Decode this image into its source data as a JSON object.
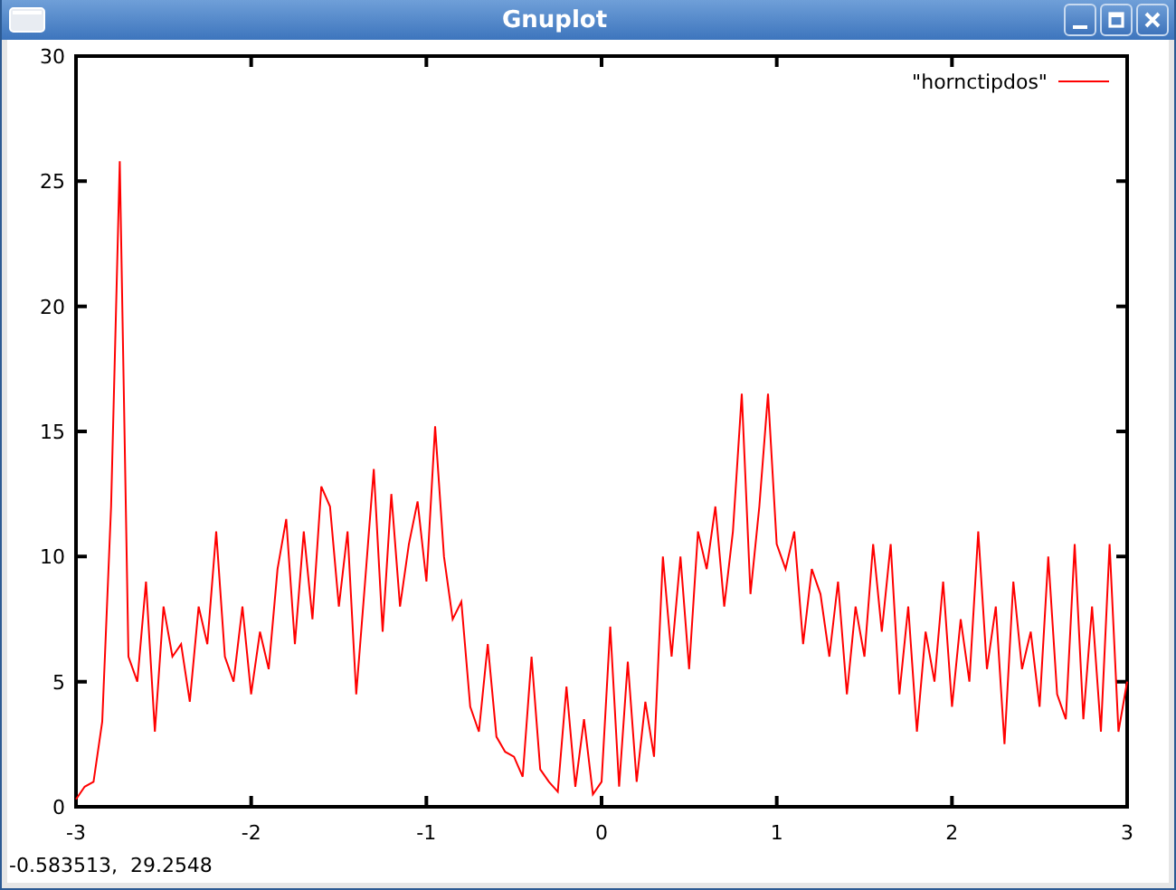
{
  "window": {
    "title": "Gnuplot"
  },
  "plot": {
    "chart_data": {
      "type": "line",
      "x": [
        -3,
        -2.95,
        -2.9,
        -2.85,
        -2.8,
        -2.75,
        -2.7,
        -2.65,
        -2.6,
        -2.55,
        -2.5,
        -2.45,
        -2.4,
        -2.35,
        -2.3,
        -2.25,
        -2.2,
        -2.15,
        -2.1,
        -2.05,
        -2,
        -1.95,
        -1.9,
        -1.85,
        -1.8,
        -1.75,
        -1.7,
        -1.65,
        -1.6,
        -1.55,
        -1.5,
        -1.45,
        -1.4,
        -1.35,
        -1.3,
        -1.25,
        -1.2,
        -1.15,
        -1.1,
        -1.05,
        -1,
        -0.95,
        -0.9,
        -0.85,
        -0.8,
        -0.75,
        -0.7,
        -0.65,
        -0.6,
        -0.55,
        -0.5,
        -0.45,
        -0.4,
        -0.35,
        -0.3,
        -0.25,
        -0.2,
        -0.15,
        -0.1,
        -0.05,
        0,
        0.05,
        0.1,
        0.15,
        0.2,
        0.25,
        0.3,
        0.35,
        0.4,
        0.45,
        0.5,
        0.55,
        0.6,
        0.65,
        0.7,
        0.75,
        0.8,
        0.85,
        0.9,
        0.95,
        1,
        1.05,
        1.1,
        1.15,
        1.2,
        1.25,
        1.3,
        1.35,
        1.4,
        1.45,
        1.5,
        1.55,
        1.6,
        1.65,
        1.7,
        1.75,
        1.8,
        1.85,
        1.9,
        1.95,
        2,
        2.05,
        2.1,
        2.15,
        2.2,
        2.25,
        2.3,
        2.35,
        2.4,
        2.45,
        2.5,
        2.55,
        2.6,
        2.65,
        2.7,
        2.75,
        2.8,
        2.85,
        2.9,
        2.95,
        3
      ],
      "series": [
        {
          "name": "\"hornctipdos\"",
          "color": "#ff0000",
          "values": [
            0.3,
            0.8,
            1.0,
            3.4,
            12.0,
            25.8,
            6.0,
            5.0,
            9.0,
            3.0,
            8.0,
            6.0,
            6.5,
            4.2,
            8.0,
            6.5,
            11.0,
            6.0,
            5.0,
            8.0,
            4.5,
            7.0,
            5.5,
            9.5,
            11.5,
            6.5,
            11.0,
            7.5,
            12.8,
            12.0,
            8.0,
            11.0,
            4.5,
            9.0,
            13.5,
            7.0,
            12.5,
            8.0,
            10.5,
            12.2,
            9.0,
            15.2,
            10.0,
            7.5,
            8.2,
            4.0,
            3.0,
            6.5,
            2.8,
            2.2,
            2.0,
            1.2,
            6.0,
            1.5,
            1.0,
            0.6,
            4.8,
            0.8,
            3.5,
            0.5,
            1.0,
            7.2,
            0.8,
            5.8,
            1.0,
            4.2,
            2.0,
            10.0,
            6.0,
            10.0,
            5.5,
            11.0,
            9.5,
            12.0,
            8.0,
            11.0,
            16.5,
            8.5,
            12.0,
            16.5,
            10.5,
            9.5,
            11.0,
            6.5,
            9.5,
            8.5,
            6.0,
            9.0,
            4.5,
            8.0,
            6.0,
            10.5,
            7.0,
            10.5,
            4.5,
            8.0,
            3.0,
            7.0,
            5.0,
            9.0,
            4.0,
            7.5,
            5.0,
            11.0,
            5.5,
            8.0,
            2.5,
            9.0,
            5.5,
            7.0,
            4.0,
            10.0,
            4.5,
            3.5,
            10.5,
            3.5,
            8.0,
            3.0,
            10.5,
            3.0,
            5.0
          ]
        }
      ],
      "xlim": [
        -3,
        3
      ],
      "ylim": [
        0,
        30
      ],
      "xticks": [
        -3,
        -2,
        -1,
        0,
        1,
        2,
        3
      ],
      "yticks": [
        0,
        5,
        10,
        15,
        20,
        25,
        30
      ]
    }
  },
  "status_bar": {
    "text": "-0.583513,  29.2548"
  }
}
